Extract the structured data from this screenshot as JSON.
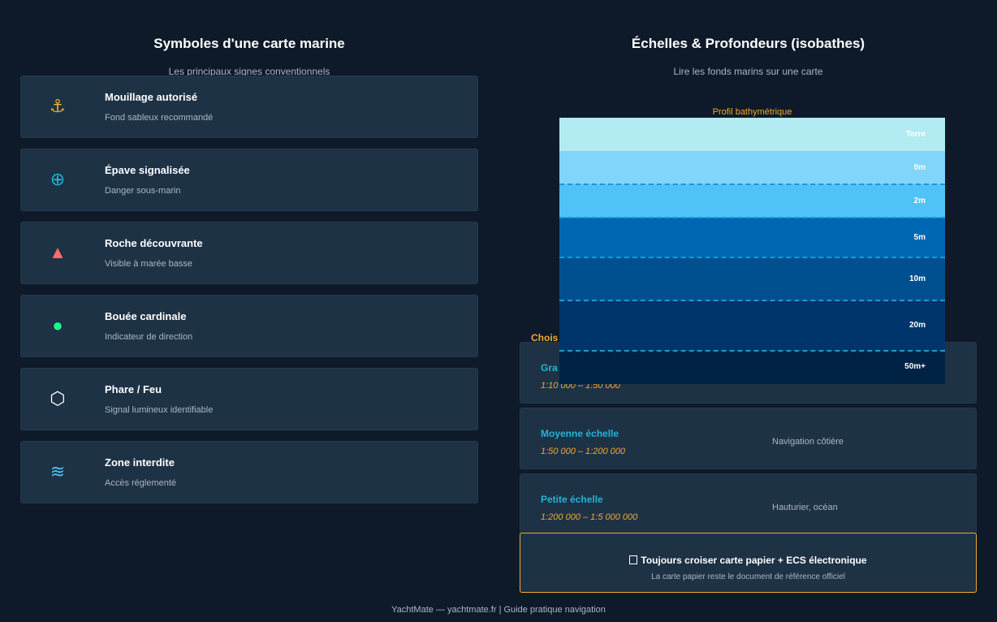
{
  "left": {
    "title": "Symboles d'une carte marine",
    "subtitle": "Les principaux signes conventionnels",
    "symbols": [
      {
        "icon": "anchor-icon",
        "glyph": "⚓",
        "color": "#f0a830",
        "name": "Mouillage autorisé",
        "desc": "Fond sableux recommandé"
      },
      {
        "icon": "wreck-icon",
        "glyph": "⊕",
        "color": "#1eb5d6",
        "name": "Épave signalisée",
        "desc": "Danger sous-marin"
      },
      {
        "icon": "rock-triangle-icon",
        "glyph": "▲",
        "color": "#ff6b6b",
        "name": "Roche découvrante",
        "desc": "Visible à marée basse"
      },
      {
        "icon": "buoy-circle-icon",
        "glyph": "●",
        "color": "#1dfa8a",
        "name": "Bouée cardinale",
        "desc": "Indicateur de direction"
      },
      {
        "icon": "lighthouse-hexagon-icon",
        "glyph": "⬡",
        "color": "#ffffff",
        "name": "Phare / Feu",
        "desc": "Signal lumineux identifiable"
      },
      {
        "icon": "waves-icon",
        "glyph": "≋",
        "color": "#4fc3f7",
        "name": "Zone interdite",
        "desc": "Accès réglementé"
      }
    ]
  },
  "right": {
    "title": "Échelles & Profondeurs (isobathes)",
    "subtitle": "Lire les fonds marins sur une carte",
    "profile_label": "Profil bathymétrique",
    "bands": [
      {
        "label": "Terre",
        "color": "#b2ebf2"
      },
      {
        "label": "0m",
        "color": "#81d4fa"
      },
      {
        "label": "2m",
        "color": "#4fc3f7"
      },
      {
        "label": "5m",
        "color": "#0067b3"
      },
      {
        "label": "10m",
        "color": "#00508f"
      },
      {
        "label": "20m",
        "color": "#00356b"
      },
      {
        "label": "50m+",
        "color": "#002345"
      }
    ],
    "choose_label": "Chois",
    "scales": [
      {
        "name": "Gra",
        "range": "1:10 000 – 1:50 000",
        "use": ""
      },
      {
        "name": "Moyenne échelle",
        "range": "1:50 000 – 1:200 000",
        "use": "Navigation côtière"
      },
      {
        "name": "Petite échelle",
        "range": "1:200 000 – 1:5 000 000",
        "use": "Hauturier, océan"
      }
    ],
    "tip": {
      "icon": "tip-icon",
      "text": "Toujours croiser carte papier + ECS électronique",
      "sub": "La carte papier reste le document de référence officiel"
    }
  },
  "footer": "YachtMate — yachtmate.fr  |  Guide pratique navigation"
}
